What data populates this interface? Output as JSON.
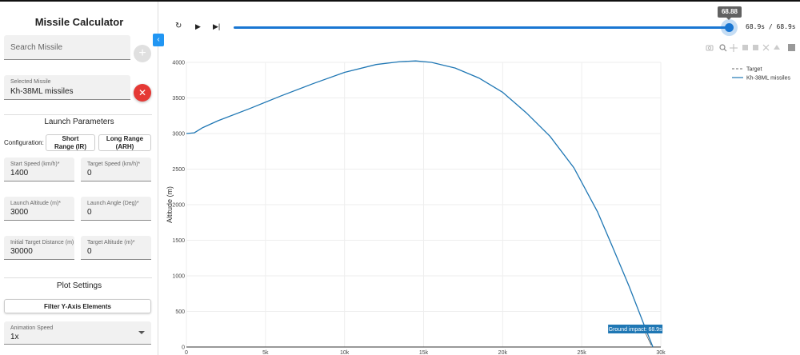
{
  "sidebar": {
    "title": "Missile Calculator",
    "search": {
      "placeholder": "Search Missile"
    },
    "selected": {
      "label": "Selected Missile",
      "value": "Kh-38ML missiles"
    },
    "launch": {
      "title": "Launch Parameters",
      "config_label": "Configuration:",
      "short_line1": "Short",
      "short_line2": "Range (IR)",
      "long_line1": "Long Range",
      "long_line2": "(ARH)",
      "fields": [
        {
          "label": "Start Speed (km/h)*",
          "value": "1400"
        },
        {
          "label": "Target Speed (km/h)*",
          "value": "0"
        },
        {
          "label": "Launch Altitude (m)*",
          "value": "3000"
        },
        {
          "label": "Launch Angle (Deg)*",
          "value": "0"
        },
        {
          "label": "Initial Target Distance (m)",
          "value": "30000"
        },
        {
          "label": "Target Altitude (m)*",
          "value": "0"
        }
      ]
    },
    "plot": {
      "title": "Plot Settings",
      "filter_label": "Filter Y-Axis Elements",
      "speed_label": "Animation Speed",
      "speed_value": "1x"
    }
  },
  "player": {
    "tooltip": "68.88",
    "time": "68.9s / 68.9s",
    "progress": 1.0,
    "icons": [
      "replay-icon",
      "play-icon",
      "skip-end-icon"
    ]
  },
  "chart_data": {
    "type": "line",
    "xlabel": "",
    "ylabel": "Altitude (m)",
    "xlim": [
      0,
      30000
    ],
    "ylim": [
      0,
      4000
    ],
    "x_ticks": [
      "0",
      "5k",
      "10k",
      "15k",
      "20k",
      "25k",
      "30k"
    ],
    "y_ticks": [
      "0",
      "500",
      "1000",
      "1500",
      "2000",
      "2500",
      "3000",
      "3500",
      "4000"
    ],
    "grid": true,
    "legend_position": "top-right",
    "annotation": {
      "text": "Ground impact: 68.9s",
      "x": 29500,
      "y": 0
    },
    "series": [
      {
        "name": "Target",
        "style": "dashed",
        "color": "#888888",
        "x": [],
        "y": []
      },
      {
        "name": "Kh-38ML missiles",
        "style": "solid",
        "color": "#1f77b4",
        "x": [
          0,
          500,
          1000,
          2000,
          4000,
          6000,
          8000,
          10000,
          12000,
          13500,
          14500,
          15500,
          17000,
          18500,
          20000,
          21500,
          23000,
          24500,
          26000,
          27000,
          28000,
          29000,
          29500
        ],
        "y": [
          3000,
          3010,
          3080,
          3180,
          3350,
          3530,
          3700,
          3860,
          3970,
          4010,
          4020,
          4000,
          3920,
          3780,
          3580,
          3290,
          2960,
          2520,
          1900,
          1380,
          850,
          280,
          0
        ]
      }
    ]
  },
  "toolbar_icons": [
    "camera-icon",
    "zoom-icon",
    "pan-icon",
    "zoom-in-icon",
    "zoom-out-icon",
    "autoscale-icon",
    "reset-axes-icon",
    "plotly-logo-icon"
  ],
  "colors": {
    "accent": "#1976d2",
    "danger": "#e53935",
    "line": "#1f77b4"
  }
}
